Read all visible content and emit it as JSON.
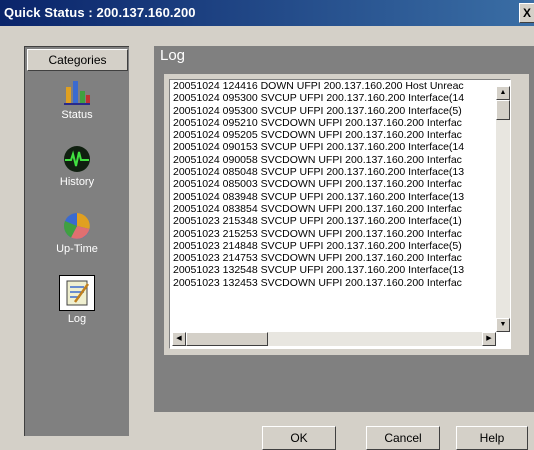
{
  "window": {
    "title": "Quick Status : 200.137.160.200",
    "close_label": "X"
  },
  "sidebar": {
    "header": "Categories",
    "items": [
      {
        "label": "Status",
        "icon": "bar-chart-icon"
      },
      {
        "label": "History",
        "icon": "heartbeat-icon"
      },
      {
        "label": "Up-Time",
        "icon": "pie-chart-icon"
      },
      {
        "label": "Log",
        "icon": "notepad-icon",
        "selected": true
      }
    ]
  },
  "main": {
    "title": "Log",
    "lines": [
      "20051024 124416 DOWN UFPI 200.137.160.200 Host Unreac",
      "20051024 095300 SVCUP UFPI 200.137.160.200 Interface(14",
      "20051024 095300 SVCUP UFPI 200.137.160.200 Interface(5)",
      "20051024 095210 SVCDOWN UFPI 200.137.160.200 Interfac",
      "20051024 095205 SVCDOWN UFPI 200.137.160.200 Interfac",
      "20051024 090153 SVCUP UFPI 200.137.160.200 Interface(14",
      "20051024 090058 SVCDOWN UFPI 200.137.160.200 Interfac",
      "20051024 085048 SVCUP UFPI 200.137.160.200 Interface(13",
      "20051024 085003 SVCDOWN UFPI 200.137.160.200 Interfac",
      "20051024 083948 SVCUP UFPI 200.137.160.200 Interface(13",
      "20051024 083854 SVCDOWN UFPI 200.137.160.200 Interfac",
      "20051023 215348 SVCUP UFPI 200.137.160.200 Interface(1)",
      "20051023 215253 SVCDOWN UFPI 200.137.160.200 Interfac",
      "20051023 214848 SVCUP UFPI 200.137.160.200 Interface(5)",
      "20051023 214753 SVCDOWN UFPI 200.137.160.200 Interfac",
      "20051023 132548 SVCUP UFPI 200.137.160.200 Interface(13",
      "20051023 132453 SVCDOWN UFPI 200.137.160.200 Interfac"
    ]
  },
  "buttons": {
    "ok": "OK",
    "cancel": "Cancel",
    "help": "Help"
  }
}
